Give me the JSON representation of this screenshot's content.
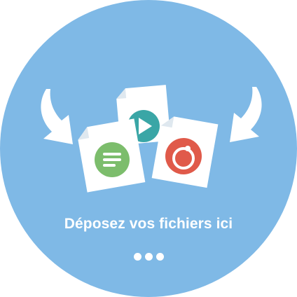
{
  "dropzone": {
    "label": "Déposez vos fichiers ici",
    "dots_count": 3
  },
  "icons": [
    "arrow-down-right-icon",
    "arrow-down-left-icon",
    "video-file-icon",
    "text-file-icon",
    "image-file-icon"
  ],
  "colors": {
    "circle": "#7fb9e6",
    "paper": "#ffffff",
    "paper_fold": "#dfe8ef",
    "text_badge": "#7cbd6c",
    "video_badge": "#3aa6a6",
    "image_badge": "#e05a4a"
  }
}
